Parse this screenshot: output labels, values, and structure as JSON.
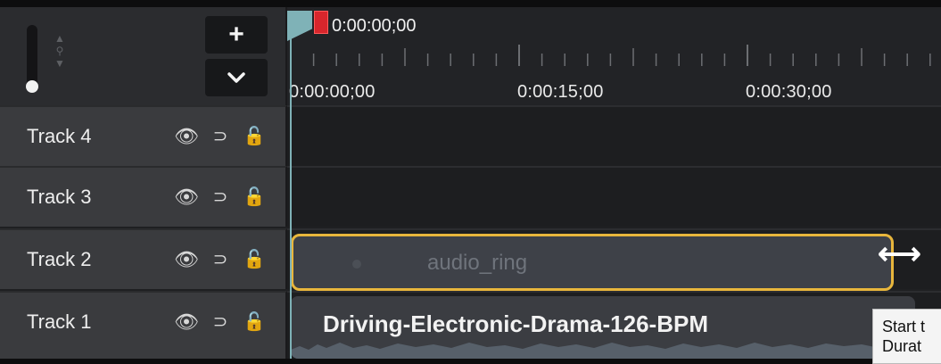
{
  "header": {
    "add_button": "+",
    "collapse_button": "⌄"
  },
  "ruler": {
    "playhead_time": "0:00:00;00",
    "time_labels": [
      "0:00:00;00",
      "0:00:15;00",
      "0:00:30;00"
    ]
  },
  "tracks": [
    {
      "name": "Track 4"
    },
    {
      "name": "Track 3"
    },
    {
      "name": "Track 2"
    },
    {
      "name": "Track 1"
    }
  ],
  "clips": {
    "ring": {
      "title": "audio_ring"
    },
    "audio": {
      "title": "Driving-Electronic-Drama-126-BPM"
    }
  },
  "tooltip": {
    "line1": "Start t",
    "line2": "Durat"
  },
  "colors": {
    "selection": "#e8b63c",
    "playhead": "#7fb2b7",
    "playhead_marker": "#d8262c"
  }
}
